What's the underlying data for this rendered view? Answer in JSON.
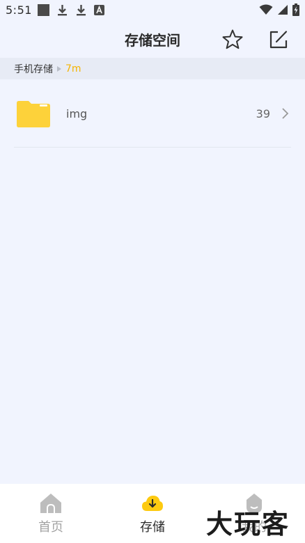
{
  "status_bar": {
    "time": "5:51",
    "icons": [
      "square-notification-icon",
      "download-icon",
      "download-icon",
      "a-notification-icon",
      "wifi-icon",
      "signal-icon",
      "battery-charging-icon"
    ]
  },
  "header": {
    "title": "存储空间",
    "star_icon": "star-icon",
    "edit_icon": "edit-icon"
  },
  "breadcrumb": {
    "root": "手机存储",
    "current": "7m",
    "accent_color": "#f5b400"
  },
  "files": [
    {
      "name": "img",
      "count": "39",
      "icon": "folder-icon"
    }
  ],
  "bottom_nav": {
    "items": [
      {
        "label": "首页",
        "icon": "home-icon",
        "active": false
      },
      {
        "label": "存储",
        "icon": "cloud-download-icon",
        "active": true
      },
      {
        "label": "我的",
        "icon": "user-icon",
        "active": false
      }
    ]
  },
  "watermark": "大玩客"
}
